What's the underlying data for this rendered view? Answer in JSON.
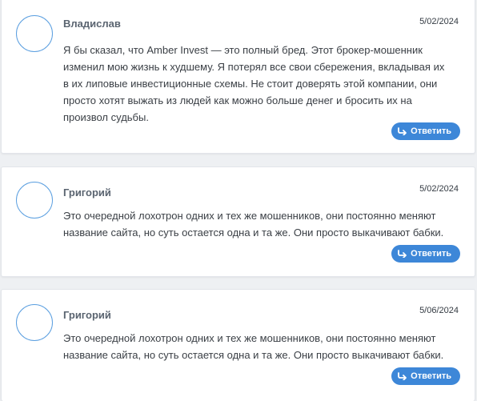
{
  "comments": [
    {
      "author": "Владислав",
      "date": "5/02/2024",
      "lines": [
        "Я бы сказал, что Amber Invest — это полный бред. Этот брокер-мошенник",
        "изменил мою жизнь к худшему. Я потерял все свои сбережения, вкладывая их",
        "в их липовые инвестиционные схемы. Не стоит доверять этой компании, они",
        "просто хотят выжать из людей как можно больше денег и бросить их на",
        "произвол судьбы."
      ],
      "reply_label": "Ответить",
      "reply_icon": "reply-arrow-icon"
    },
    {
      "author": "Григорий",
      "date": "5/02/2024",
      "lines": [
        "Это очередной лохотрон одних и тех же мошенников, они постоянно меняют",
        "название сайта, но суть остается одна и та же. Они просто выкачивают бабки."
      ],
      "reply_label": "Ответить",
      "reply_icon": "reply-arrow-icon"
    },
    {
      "author": "Григорий",
      "date": "5/06/2024",
      "lines": [
        "Это очередной лохотрон одних и тех же мошенников, они постоянно меняют",
        "название сайта, но суть остается одна и та же. Они просто выкачивают бабки."
      ],
      "reply_label": "Ответить",
      "reply_icon": "reply-arrow-icon"
    }
  ],
  "colors": {
    "accent": "#3d87d8",
    "avatar_border": "#5b9fe0",
    "author": "#5a6470",
    "text": "#3a3f45",
    "background": "#eef0f3"
  }
}
